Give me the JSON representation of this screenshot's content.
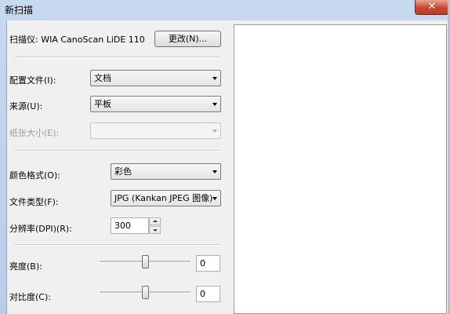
{
  "window": {
    "title": "新扫描",
    "close_label": "✕"
  },
  "scanner": {
    "label": "扫描仪: WIA CanoScan LiDE 110",
    "change_button": "更改(N)..."
  },
  "profile": {
    "label": "配置文件(I):",
    "value": "文档"
  },
  "source": {
    "label": "来源(U):",
    "value": "平板"
  },
  "paper_size": {
    "label": "纸张大小(E):",
    "value": ""
  },
  "color_format": {
    "label": "颜色格式(O):",
    "value": "彩色"
  },
  "file_type": {
    "label": "文件类型(F):",
    "value": "JPG (Kankan JPEG 图像)"
  },
  "resolution": {
    "label": "分辨率(DPI)(R):",
    "value": "300"
  },
  "brightness": {
    "label": "亮度(B):",
    "value": "0",
    "level": 0.5
  },
  "contrast": {
    "label": "对比度(C):",
    "value": "0",
    "level": 0.5
  }
}
